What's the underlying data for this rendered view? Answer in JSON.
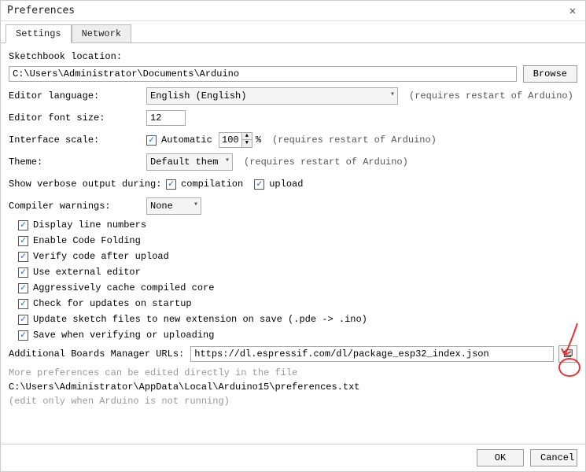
{
  "window": {
    "title": "Preferences"
  },
  "tabs": {
    "settings": "Settings",
    "network": "Network"
  },
  "sketchbook": {
    "label": "Sketchbook location:",
    "value": "C:\\Users\\Administrator\\Documents\\Arduino",
    "browse": "Browse"
  },
  "language": {
    "label": "Editor language:",
    "value": "English (English)",
    "note": "(requires restart of Arduino)"
  },
  "fontsize": {
    "label": "Editor font size:",
    "value": "12"
  },
  "scale": {
    "label": "Interface scale:",
    "auto_label": "Automatic",
    "value": "100",
    "pct": "%",
    "note": "(requires restart of Arduino)"
  },
  "theme": {
    "label": "Theme:",
    "value": "Default theme",
    "note": "(requires restart of Arduino)"
  },
  "verbose": {
    "label": "Show verbose output during:",
    "compilation": "compilation",
    "upload": "upload"
  },
  "compiler_warnings": {
    "label": "Compiler warnings:",
    "value": "None"
  },
  "options": {
    "line_numbers": "Display line numbers",
    "code_folding": "Enable Code Folding",
    "verify_after_upload": "Verify code after upload",
    "external_editor": "Use external editor",
    "cache_core": "Aggressively cache compiled core",
    "check_updates": "Check for updates on startup",
    "update_extension": "Update sketch files to new extension on save (.pde -> .ino)",
    "save_verify": "Save when verifying or uploading"
  },
  "boards_url": {
    "label": "Additional Boards Manager URLs:",
    "value": "https://dl.espressif.com/dl/package_esp32_index.json"
  },
  "more_prefs": {
    "line1": "More preferences can be edited directly in the file",
    "path": "C:\\Users\\Administrator\\AppData\\Local\\Arduino15\\preferences.txt",
    "line2": "(edit only when Arduino is not running)"
  },
  "footer": {
    "ok": "OK",
    "cancel": "Cancel"
  }
}
